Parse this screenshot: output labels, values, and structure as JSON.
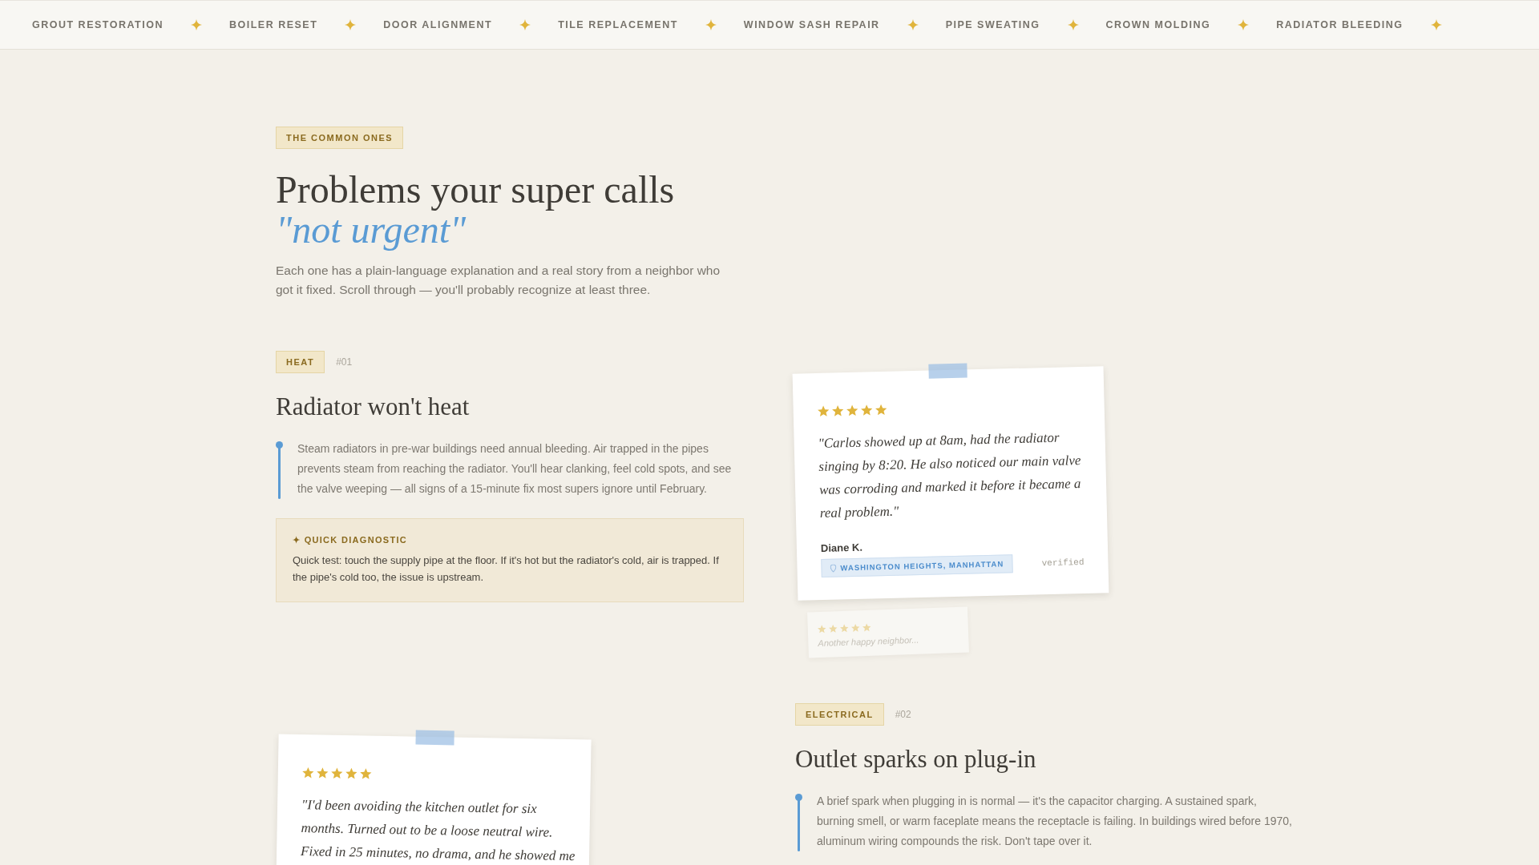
{
  "nav": {
    "items": [
      {
        "label": "GROUT RESTORATION"
      },
      {
        "label": "BOILER RESET"
      },
      {
        "label": "DOOR ALIGNMENT"
      },
      {
        "label": "TILE REPLACEMENT"
      },
      {
        "label": "WINDOW SASH REPAIR"
      },
      {
        "label": "PIPE SWEATING"
      },
      {
        "label": "CROWN MOLDING"
      },
      {
        "label": "RADIATOR BLEEDING"
      }
    ]
  },
  "intro": {
    "eyebrow": "THE COMMON ONES",
    "title": "Problems your super calls",
    "title_accent": "\"not urgent\"",
    "subtitle": "Each one has a plain-language explanation and a real story from a neighbor who got it fixed. Scroll through — you'll probably recognize at least three."
  },
  "problems": [
    {
      "category": "HEAT",
      "number": "#01",
      "title": "Radiator won't heat",
      "body": "Steam radiators in pre-war buildings need annual bleeding. Air trapped in the pipes prevents steam from reaching the radiator. You'll hear clanking, feel cold spots, and see the valve weeping — all signs of a 15-minute fix most supers ignore until February.",
      "diagnostic": {
        "label": "✦ QUICK DIAGNOSTIC",
        "text": "Quick test: touch the supply pipe at the floor. If it's hot but the radiator's cold, air is trapped. If the pipe's cold too, the issue is upstream."
      },
      "review": {
        "stars": 5,
        "quote": "\"Carlos showed up at 8am, had the radiator singing by 8:20. He also noticed our main valve was corroding and marked it before it became a real problem.\"",
        "author": "Diane K.",
        "location": "WASHINGTON HEIGHTS, MANHATTAN",
        "status": "verified",
        "next": {
          "stars": 5,
          "text": "Another happy neighbor..."
        }
      }
    },
    {
      "category": "ELECTRICAL",
      "number": "#02",
      "title": "Outlet sparks on plug-in",
      "body": "A brief spark when plugging in is normal — it's the capacitor charging. A sustained spark, burning smell, or warm faceplate means the receptacle is failing. In buildings wired before 1970, aluminum wiring compounds the risk. Don't tape over it.",
      "review": {
        "stars": 5,
        "quote": "\"I'd been avoiding the kitchen outlet for six months. Turned out to be a loose neutral wire. Fixed in 25 minutes, no drama, and he showed me"
      }
    }
  ]
}
